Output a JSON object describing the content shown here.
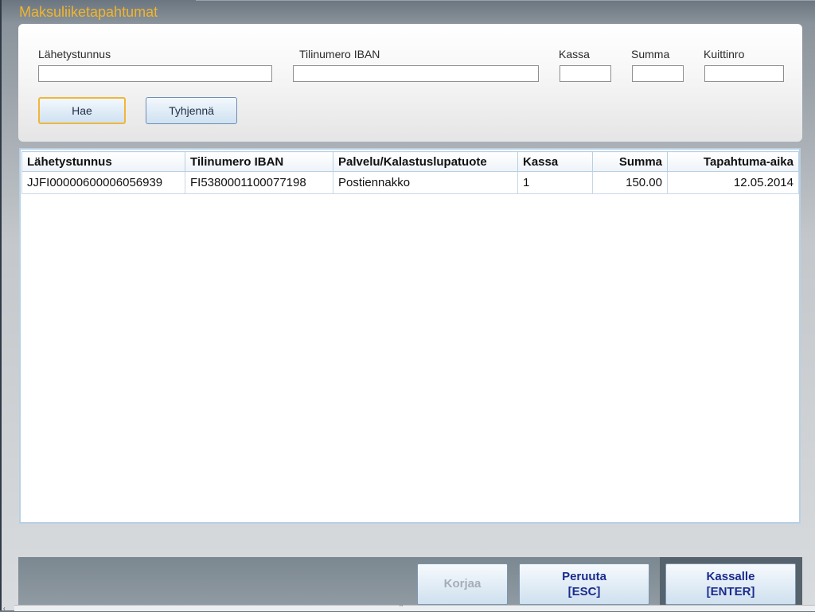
{
  "window": {
    "title": "Maksuliiketapahtumat"
  },
  "search": {
    "lahetystunnus_label": "Lähetystunnus",
    "lahetystunnus_value": "",
    "iban_label": "Tilinumero IBAN",
    "iban_value": "",
    "kassa_label": "Kassa",
    "kassa_value": "",
    "summa_label": "Summa",
    "summa_value": "",
    "kuittinro_label": "Kuittinro",
    "kuittinro_value": "",
    "hae_label": "Hae",
    "tyhjenna_label": "Tyhjennä"
  },
  "table": {
    "columns": [
      "Lähetystunnus",
      "Tilinumero IBAN",
      "Palvelu/Kalastuslupatuote",
      "Kassa",
      "Summa",
      "Tapahtuma-aika"
    ],
    "rows": [
      [
        "JJFI00000600006056939",
        "FI5380001100077198",
        "Postiennakko",
        "1",
        "150.00",
        "12.05.2014"
      ]
    ]
  },
  "footer": {
    "korjaa_label": "Korjaa",
    "peruuta_label": "Peruuta",
    "peruuta_key": "[ESC]",
    "kassalle_label": "Kassalle",
    "kassalle_key": "[ENTER]"
  },
  "scrollbar": {
    "thumb_glyph": "'''",
    "arrow_glyph": "‹"
  },
  "colors": {
    "title": "#f1b52c",
    "focus_border": "#f0b63a",
    "primary_text": "#1a2b8c"
  }
}
